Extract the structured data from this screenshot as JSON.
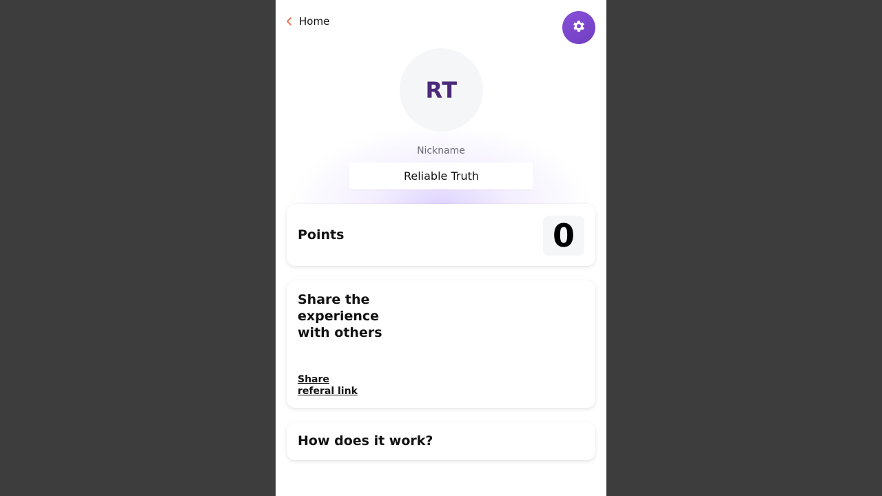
{
  "nav": {
    "back_label": "Home",
    "back_icon": "chevron-left-icon",
    "settings_icon": "gear-icon"
  },
  "profile": {
    "initials": "RT",
    "nickname_label": "Nickname",
    "nickname_value": "Reliable Truth"
  },
  "points": {
    "label": "Points",
    "value": "0"
  },
  "share": {
    "title": "Share the experience with others",
    "link_label": "Share referal link"
  },
  "how": {
    "title": "How does it work?"
  },
  "colors": {
    "accent": "#7b45cc",
    "back_chevron": "#e8795a",
    "avatar_text": "#4b2a7a"
  }
}
